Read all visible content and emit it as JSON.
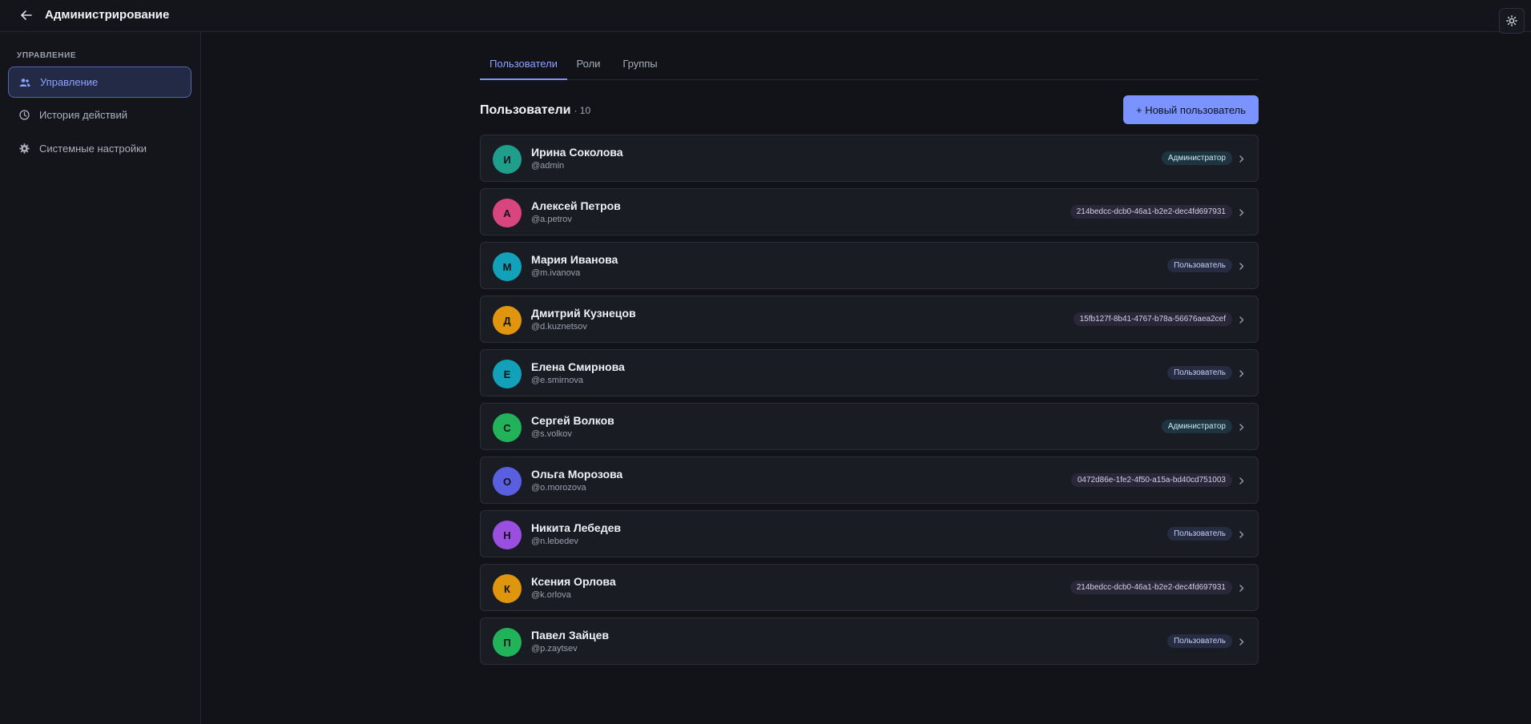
{
  "header": {
    "title": "Администрирование"
  },
  "sidebar": {
    "section_label": "УПРАВЛЕНИЕ",
    "items": [
      {
        "label": "Управление"
      },
      {
        "label": "История действий"
      },
      {
        "label": "Системные настройки"
      }
    ]
  },
  "tabs": [
    {
      "label": "Пользователи"
    },
    {
      "label": "Роли"
    },
    {
      "label": "Группы"
    }
  ],
  "list": {
    "title": "Пользователи",
    "count": "· 10",
    "new_button_label": "+ Новый пользователь"
  },
  "users": [
    {
      "initial": "И",
      "name": "Ирина Соколова",
      "login": "@admin",
      "badge": "Администратор",
      "badge_kind": "admin",
      "avatar_color": "#1f9e8c"
    },
    {
      "initial": "А",
      "name": "Алексей Петров",
      "login": "@a.petrov",
      "badge": "214bedcc-dcb0-46a1-b2e2-dec4fd697931",
      "badge_kind": "id",
      "avatar_color": "#d9457f"
    },
    {
      "initial": "М",
      "name": "Мария Иванова",
      "login": "@m.ivanova",
      "badge": "Пользователь",
      "badge_kind": "user",
      "avatar_color": "#12a1b8"
    },
    {
      "initial": "Д",
      "name": "Дмитрий Кузнецов",
      "login": "@d.kuznetsov",
      "badge": "15fb127f-8b41-4767-b78a-56676aea2cef",
      "badge_kind": "id",
      "avatar_color": "#e0950f"
    },
    {
      "initial": "Е",
      "name": "Елена Смирнова",
      "login": "@e.smirnova",
      "badge": "Пользователь",
      "badge_kind": "user",
      "avatar_color": "#12a1b8"
    },
    {
      "initial": "С",
      "name": "Сергей Волков",
      "login": "@s.volkov",
      "badge": "Администратор",
      "badge_kind": "admin",
      "avatar_color": "#22b35a"
    },
    {
      "initial": "О",
      "name": "Ольга Морозова",
      "login": "@o.morozova",
      "badge": "0472d86e-1fe2-4f50-a15a-bd40cd751003",
      "badge_kind": "id",
      "avatar_color": "#5a5fe0"
    },
    {
      "initial": "Н",
      "name": "Никита Лебедев",
      "login": "@n.lebedev",
      "badge": "Пользователь",
      "badge_kind": "user",
      "avatar_color": "#9b4fe0"
    },
    {
      "initial": "К",
      "name": "Ксения Орлова",
      "login": "@k.orlova",
      "badge": "214bedcc-dcb0-46a1-b2e2-dec4fd697931",
      "badge_kind": "id",
      "avatar_color": "#e0950f"
    },
    {
      "initial": "П",
      "name": "Павел Зайцев",
      "login": "@p.zaytsev",
      "badge": "Пользователь",
      "badge_kind": "user",
      "avatar_color": "#22b35a"
    }
  ]
}
